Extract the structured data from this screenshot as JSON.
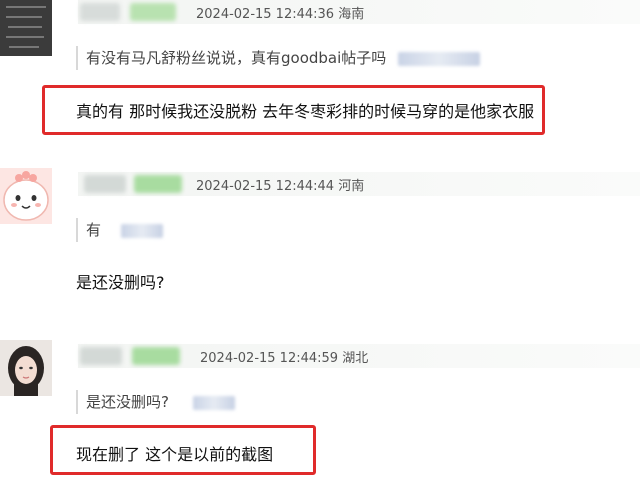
{
  "posts": [
    {
      "timestamp": "2024-02-15 12:44:36",
      "location": "海南",
      "quote": "有没有马凡舒粉丝说说，真有goodbai帖子吗",
      "reply": "真的有 那时候我还没脱粉 去年冬枣彩排的时候马穿的是他家衣服",
      "highlighted": true
    },
    {
      "timestamp": "2024-02-15 12:44:44",
      "location": "河南",
      "quote": "有",
      "reply": "是还没删吗?",
      "highlighted": false
    },
    {
      "timestamp": "2024-02-15 12:44:59",
      "location": "湖北",
      "quote": "是还没删吗?",
      "reply": "现在删了 这个是以前的截图",
      "highlighted": true
    }
  ],
  "colors": {
    "highlight_border": "#e02a2a",
    "meta_bar": "#f3f5f3",
    "name_blur_green": "#a8dca0",
    "name_blur_gray": "#d3d9d6"
  }
}
